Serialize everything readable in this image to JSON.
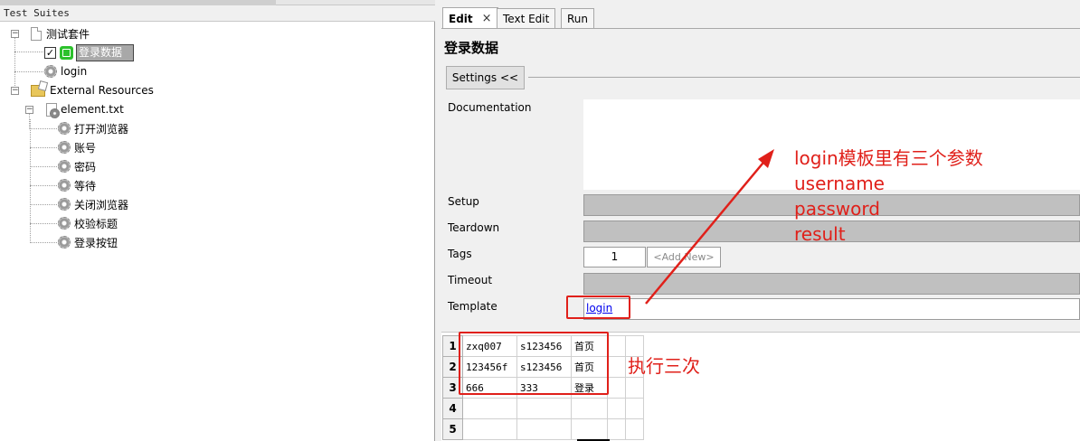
{
  "left_panel": {
    "header": "Test Suites",
    "tree": {
      "suite": {
        "label": "测试套件"
      },
      "testcase": {
        "label": "登录数据",
        "checked": true
      },
      "keyword_login": {
        "label": "login"
      },
      "external": {
        "label": "External Resources"
      },
      "resource_file": {
        "label": "element.txt"
      },
      "keywords": [
        "打开浏览器",
        "账号",
        "密码",
        "等待",
        "关闭浏览器",
        "校验标题",
        "登录按钮"
      ]
    }
  },
  "tabs": [
    {
      "label": "Edit",
      "active": true,
      "close": "×"
    },
    {
      "label": "Text Edit",
      "active": false
    },
    {
      "label": "Run",
      "active": false
    }
  ],
  "editor": {
    "title": "登录数据",
    "settings_button": "Settings <<",
    "labels": {
      "documentation": "Documentation",
      "setup": "Setup",
      "teardown": "Teardown",
      "tags": "Tags",
      "timeout": "Timeout",
      "template": "Template"
    },
    "tag_value": "1",
    "tag_add": "<Add New>",
    "template_value": "login"
  },
  "grid": {
    "rows": [
      {
        "num": "1",
        "cells": [
          "zxq007",
          "s123456",
          "首页",
          "",
          ""
        ]
      },
      {
        "num": "2",
        "cells": [
          "123456f",
          "s123456",
          "首页",
          "",
          ""
        ]
      },
      {
        "num": "3",
        "cells": [
          "666",
          "333",
          "登录",
          "",
          ""
        ]
      },
      {
        "num": "4",
        "cells": [
          "",
          "",
          "",
          "",
          ""
        ]
      },
      {
        "num": "5",
        "cells": [
          "",
          "",
          "",
          "",
          ""
        ]
      }
    ]
  },
  "annotations": {
    "params_note": [
      "login模板里有三个参数",
      "username",
      "password",
      "result"
    ],
    "exec_note": "执行三次",
    "color": "#e0201a"
  }
}
